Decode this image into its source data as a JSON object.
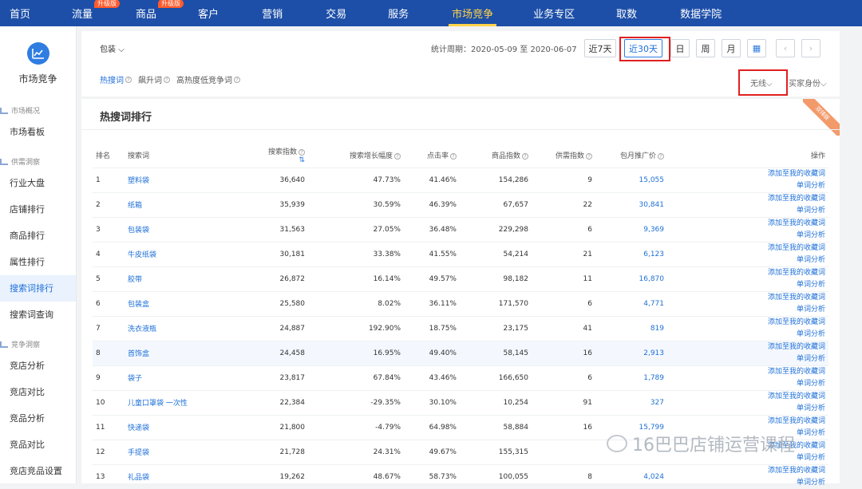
{
  "nav": {
    "items": [
      {
        "label": "首页",
        "badge": ""
      },
      {
        "label": "流量",
        "badge": "升级版"
      },
      {
        "label": "商品",
        "badge": "升级版"
      },
      {
        "label": "客户",
        "badge": ""
      },
      {
        "label": "营销",
        "badge": ""
      },
      {
        "label": "交易",
        "badge": ""
      },
      {
        "label": "服务",
        "badge": ""
      },
      {
        "label": "市场竞争",
        "badge": ""
      },
      {
        "label": "业务专区",
        "badge": ""
      },
      {
        "label": "取数",
        "badge": ""
      },
      {
        "label": "数据学院",
        "badge": ""
      }
    ],
    "active": "市场竞争"
  },
  "sidebar": {
    "title": "市场竞争",
    "groups": [
      {
        "label": "市场概况",
        "items": [
          "市场看板"
        ]
      },
      {
        "label": "供需洞察",
        "items": [
          "行业大盘",
          "店铺排行",
          "商品排行",
          "属性排行",
          "搜索词排行",
          "搜索词查询"
        ]
      },
      {
        "label": "竞争洞察",
        "items": [
          "竞店分析",
          "竞店对比",
          "竞品分析",
          "竞品对比",
          "竞店竞品设置"
        ]
      }
    ],
    "active": "搜索词排行"
  },
  "filters": {
    "device": "包装",
    "period_label": "统计周期：2020-05-09 至 2020-06-07",
    "buttons": [
      "近7天",
      "近30天",
      "日",
      "周",
      "月"
    ],
    "selected": "近30天",
    "tabs": [
      "热搜词",
      "飙升词",
      "高热度低竞争词"
    ],
    "active_tab": "热搜词",
    "wireless": "无线",
    "buyer": "买家身份"
  },
  "card": {
    "title": "热搜词排行",
    "ribbon": "双排版"
  },
  "table": {
    "headers": [
      "排名",
      "搜索词",
      "搜索指数",
      "搜索增长幅度",
      "点击率",
      "商品指数",
      "供需指数",
      "包月推广价",
      "操作"
    ],
    "op_labels": [
      "添加至我的收藏词",
      "单词分析"
    ],
    "rows": [
      [
        "1",
        "塑料袋",
        "36,640",
        "47.73%",
        "41.46%",
        "154,286",
        "9",
        "15,055"
      ],
      [
        "2",
        "纸箱",
        "35,939",
        "30.59%",
        "46.39%",
        "67,657",
        "22",
        "30,841"
      ],
      [
        "3",
        "包装袋",
        "31,563",
        "27.05%",
        "36.48%",
        "229,298",
        "6",
        "9,369"
      ],
      [
        "4",
        "牛皮纸袋",
        "30,181",
        "33.38%",
        "41.55%",
        "54,214",
        "21",
        "6,123"
      ],
      [
        "5",
        "胶带",
        "26,872",
        "16.14%",
        "49.57%",
        "98,182",
        "11",
        "16,870"
      ],
      [
        "6",
        "包装盒",
        "25,580",
        "8.02%",
        "36.11%",
        "171,570",
        "6",
        "4,771"
      ],
      [
        "7",
        "洗衣液瓶",
        "24,887",
        "192.90%",
        "18.75%",
        "23,175",
        "41",
        "819"
      ],
      [
        "8",
        "首饰盒",
        "24,458",
        "16.95%",
        "49.40%",
        "58,145",
        "16",
        "2,913"
      ],
      [
        "9",
        "袋子",
        "23,817",
        "67.84%",
        "43.46%",
        "166,650",
        "6",
        "1,789"
      ],
      [
        "10",
        "儿童口罩袋 一次性",
        "22,384",
        "-29.35%",
        "30.10%",
        "10,254",
        "91",
        "327"
      ],
      [
        "11",
        "快递袋",
        "21,800",
        "-4.79%",
        "64.98%",
        "58,884",
        "16",
        "15,799"
      ],
      [
        "12",
        "手提袋",
        "21,728",
        "24.31%",
        "49.67%",
        "155,315",
        "",
        ""
      ],
      [
        "13",
        "礼品袋",
        "19,262",
        "48.67%",
        "58.73%",
        "100,055",
        "8",
        "4,024"
      ]
    ],
    "highlight_row": 8
  },
  "watermark": "16巴巴店铺运营课程"
}
